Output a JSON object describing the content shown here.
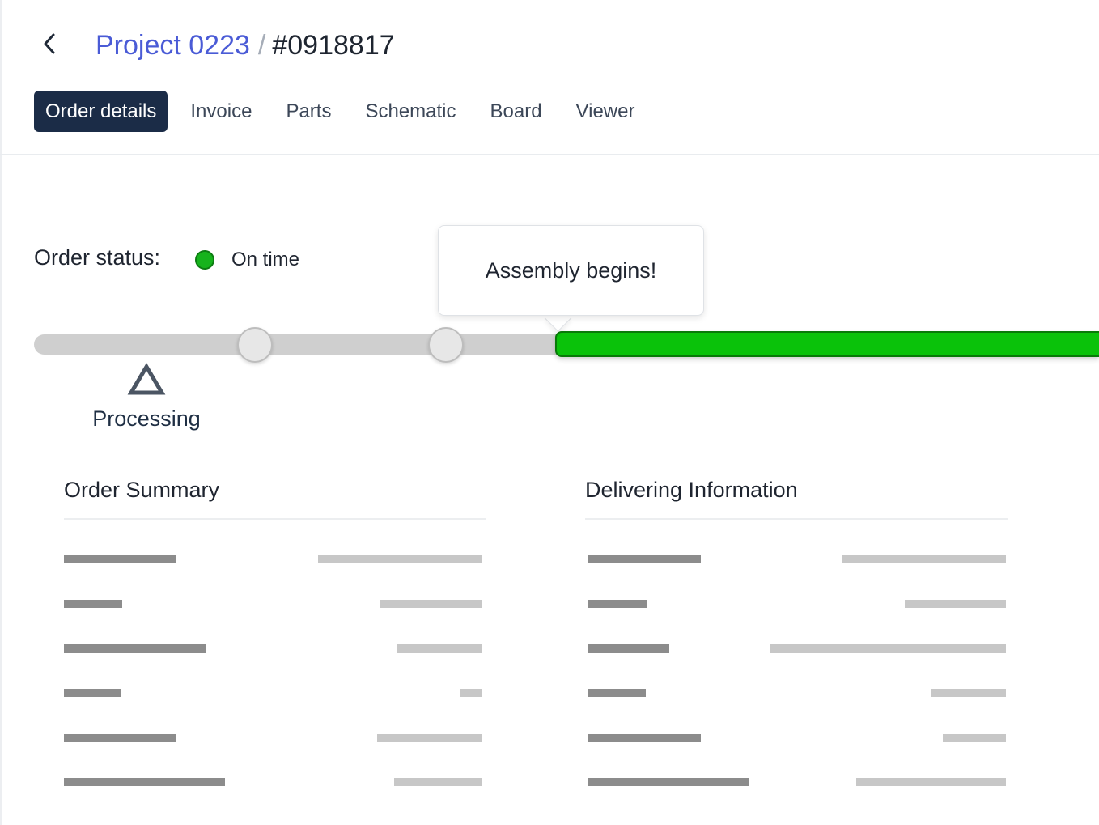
{
  "header": {
    "back_icon": "chevron-left-icon",
    "project": "Project 0223",
    "separator": "/",
    "order_number": "#0918817"
  },
  "tabs": [
    {
      "label": "Order details",
      "active": true
    },
    {
      "label": "Invoice",
      "active": false
    },
    {
      "label": "Parts",
      "active": false
    },
    {
      "label": "Schematic",
      "active": false
    },
    {
      "label": "Board",
      "active": false
    },
    {
      "label": "Viewer",
      "active": false
    }
  ],
  "status": {
    "label": "Order status:",
    "value": "On time",
    "dot_color": "#16b31c"
  },
  "timeline": {
    "tooltip": "Assembly begins!",
    "current_phase": "Processing",
    "phase_icon": "triangle-outline-icon",
    "track_color": "#cfcfcf",
    "fill_color": "#0ac20a",
    "milestones": 2
  },
  "order_summary": {
    "title": "Order Summary"
  },
  "delivering_information": {
    "title": "Delivering Information"
  },
  "colors": {
    "accent": "#4a5bd6",
    "active_tab": "#1b2c47",
    "success": "#16b31c"
  }
}
